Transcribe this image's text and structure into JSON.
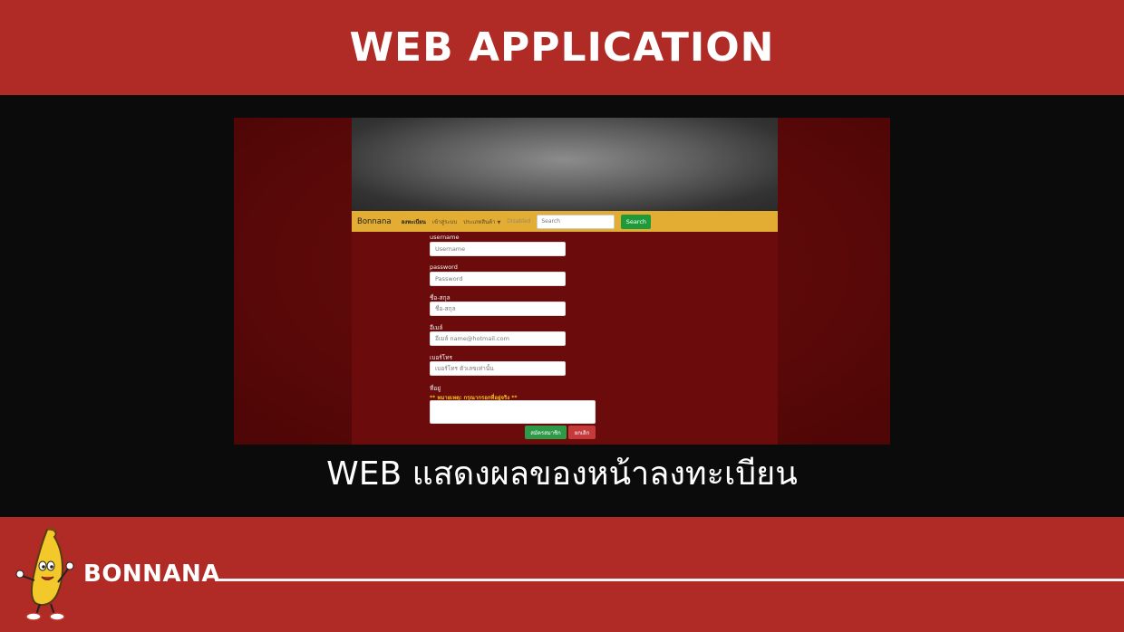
{
  "banner": {
    "title": "WEB APPLICATION"
  },
  "screenshot": {
    "navbar": {
      "brand": "Bonnana",
      "links": [
        "ลงทะเบียน",
        "เข้าสู่ระบบ",
        "ประเภทสินค้า",
        "Disabled"
      ],
      "search_placeholder": "Search",
      "search_button": "Search"
    },
    "form": {
      "username_label": "username",
      "username_placeholder": "Username",
      "password_label": "password",
      "password_placeholder": "Password",
      "fullname_label": "ชื่อ-สกุล",
      "fullname_placeholder": "ชื่อ-สกุล",
      "email_label": "อีเมล์",
      "email_placeholder": "อีเมล์ name@hotmail.com",
      "phone_label": "เบอร์โทร",
      "phone_placeholder": "เบอร์โทร ตัวเลขเท่านั้น",
      "address_label": "ที่อยู่",
      "address_note": "** หมายเหตุ: กรุณากรอกที่อยู่จริง **",
      "submit_label": "สมัครสมาชิก",
      "cancel_label": "ยกเลิก"
    }
  },
  "caption": "WEB แสดงผลของหน้าลงทะเบียน",
  "footer": {
    "brand": "BONNANA"
  },
  "colors": {
    "banner": "#b02a26",
    "navbar": "#e3ac32",
    "page_bg": "#6b0b0b",
    "success": "#2d9a47",
    "danger": "#c43a3a"
  },
  "icons": [
    "banana-mascot-icon",
    "caret-down-icon"
  ]
}
